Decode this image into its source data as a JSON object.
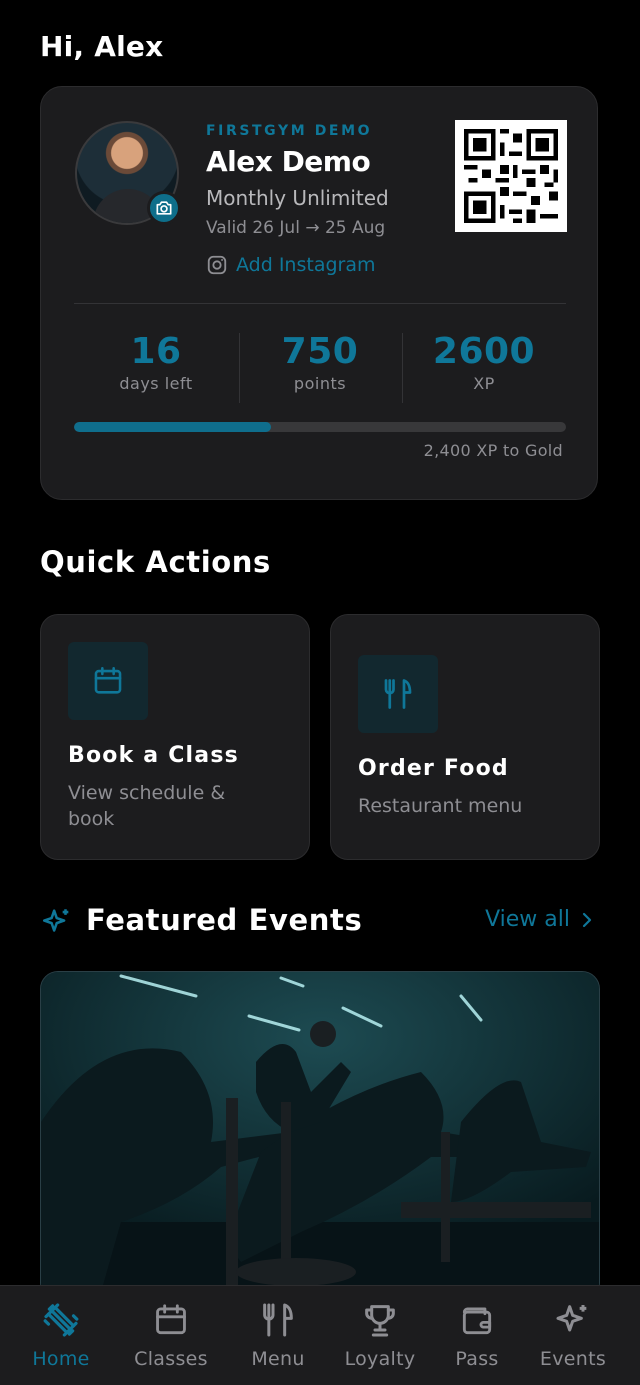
{
  "greeting": "Hi, Alex",
  "member": {
    "gym_name": "FIRSTGYM DEMO",
    "name": "Alex Demo",
    "plan": "Monthly Unlimited",
    "validity": "Valid 26 Jul → 25 Aug",
    "instagram_link": "Add Instagram"
  },
  "stats": [
    {
      "value": "16",
      "label": "days left"
    },
    {
      "value": "750",
      "label": "points"
    },
    {
      "value": "2600",
      "label": "XP"
    }
  ],
  "progress": {
    "fraction": 0.4,
    "label": "2,400 XP to Gold"
  },
  "quick_actions": {
    "title": "Quick Actions",
    "items": [
      {
        "title": "Book a Class",
        "subtitle_line1": "View schedule &",
        "subtitle_line2": "book",
        "icon": "calendar-icon"
      },
      {
        "title": "Order Food",
        "subtitle_line1": "Restaurant menu",
        "icon": "utensils-icon"
      }
    ]
  },
  "featured_events": {
    "title": "Featured Events",
    "view_all": "View all",
    "icon": "sparkle-icon"
  },
  "tabs": [
    {
      "label": "Home",
      "icon": "dumbbell-icon",
      "active": true
    },
    {
      "label": "Classes",
      "icon": "calendar-icon",
      "active": false
    },
    {
      "label": "Menu",
      "icon": "utensils-icon",
      "active": false
    },
    {
      "label": "Loyalty",
      "icon": "trophy-icon",
      "active": false
    },
    {
      "label": "Pass",
      "icon": "wallet-icon",
      "active": false
    },
    {
      "label": "Events",
      "icon": "sparkle-icon",
      "active": false
    }
  ],
  "colors": {
    "accent": "#0f7799",
    "background": "#000000",
    "card": "#1c1c1e",
    "muted_text": "#8e8e93"
  }
}
